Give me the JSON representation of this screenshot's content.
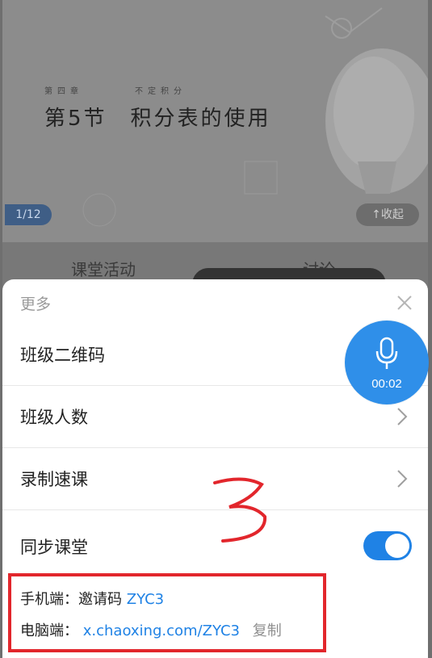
{
  "slide": {
    "chapter_no": "第四章",
    "chapter_name": "不定积分",
    "title": "第5节　积分表的使用",
    "page_indicator": "1/12",
    "collapse_label": "↑收起"
  },
  "behind_tabs": {
    "activity": "课堂活动",
    "discussion": "讨论"
  },
  "sheet": {
    "title": "更多",
    "items": [
      {
        "label": "班级二维码"
      },
      {
        "label": "班级人数"
      },
      {
        "label": "录制速课"
      },
      {
        "label": "同步课堂"
      }
    ],
    "sync_enabled": true,
    "mobile_prefix": "手机端：邀请码",
    "invite_code": "ZYC3",
    "pc_prefix": "电脑端：",
    "pc_url": "x.chaoxing.com/ZYC3",
    "copy_label": "复制"
  },
  "mic": {
    "timer": "00:02",
    "color": "#2f8fe9"
  },
  "colors": {
    "accent": "#1f82e5",
    "annotation": "#e2262c"
  }
}
